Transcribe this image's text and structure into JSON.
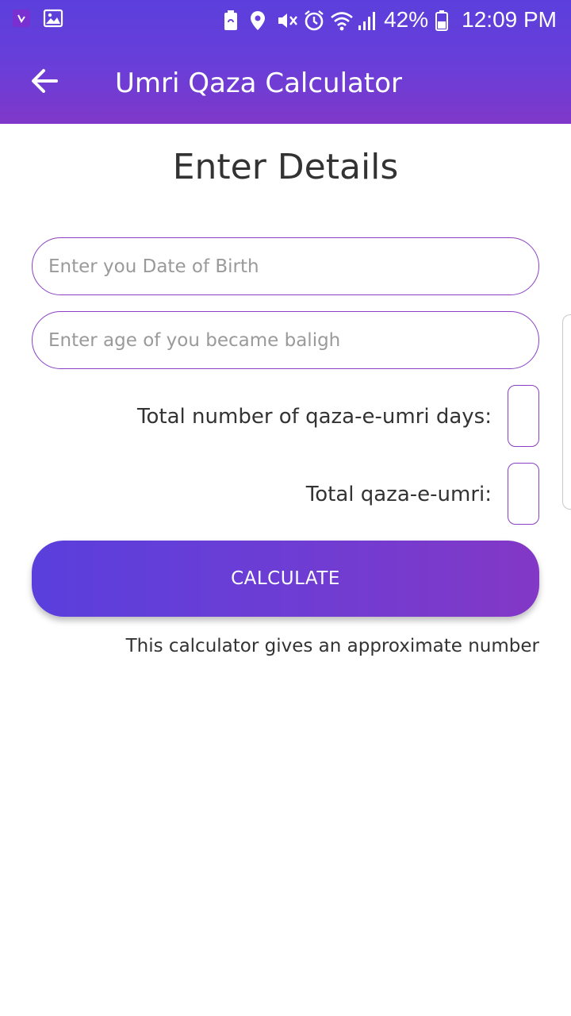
{
  "status_bar": {
    "battery_percent": "42%",
    "time": "12:09 PM",
    "icons": [
      "app-notification-icon",
      "image-icon",
      "battery-saver-icon",
      "location-icon",
      "mute-icon",
      "alarm-icon",
      "wifi-icon",
      "signal-icon",
      "battery-icon"
    ]
  },
  "toolbar": {
    "back_icon": "arrow-left-icon",
    "title": "Umri Qaza Calculator"
  },
  "page": {
    "title": "Enter Details"
  },
  "form": {
    "dob_placeholder": "Enter you Date of Birth",
    "dob_value": "",
    "baligh_placeholder": "Enter age of you became baligh",
    "baligh_value": ""
  },
  "results": {
    "days_label": "Total number of qaza-e-umri days:",
    "days_value": "",
    "total_label": "Total qaza-e-umri:",
    "total_value": ""
  },
  "actions": {
    "calculate_label": "CALCULATE"
  },
  "note": "This calculator gives an approximate number",
  "colors": {
    "primary": "#5b3fdc",
    "accent": "#8338c6",
    "text": "#333333",
    "placeholder": "#9a9a9a"
  }
}
